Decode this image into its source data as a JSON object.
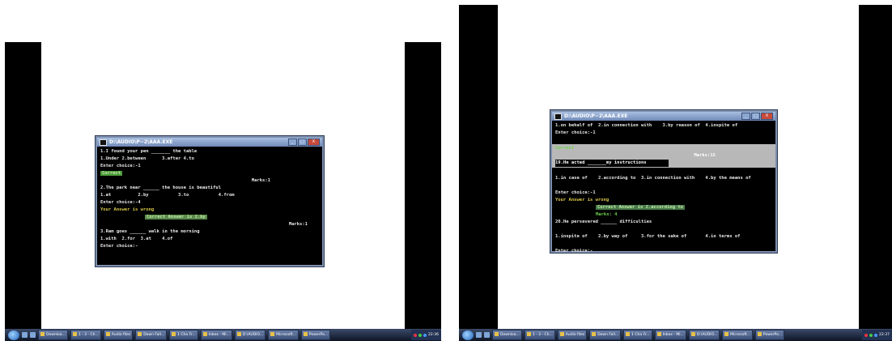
{
  "screens": [
    {
      "window": {
        "title": "D:\\AUDIO\\P~2\\AAA.EXE",
        "buttons": [
          "_",
          "□",
          "X"
        ],
        "lines": [
          {
            "text": "1.I found your pen _______ the table",
            "style": ""
          },
          {
            "text": "1.Under 2.between      3.after 4.to",
            "style": ""
          },
          {
            "text": "Enter choice:-1",
            "style": ""
          },
          {
            "text": "Correct",
            "style": "green-highlight"
          },
          {
            "text": "Marks:1",
            "style": "marks"
          },
          {
            "text": "2.The park near ______ the house is beautiful",
            "style": ""
          },
          {
            "text": "1.at          2.by           3.to           4.from",
            "style": ""
          },
          {
            "text": "Enter choice:-4",
            "style": ""
          },
          {
            "text": "Your Answer is wrong",
            "style": "yellow"
          },
          {
            "text": "Correct Answer is 2.by",
            "style": "answer"
          },
          {
            "text": "Marks:1",
            "style": "marks"
          },
          {
            "text": "3.Ram goes ______ walk in the morning",
            "style": ""
          },
          {
            "text": "1.with  2.for  3.at    4.of",
            "style": ""
          },
          {
            "text": "Enter choice:-",
            "style": ""
          }
        ]
      },
      "taskbar": {
        "items": [
          "Downloa...",
          "1 - 3 - Ch...",
          "Audio files",
          "Down Fall...",
          "1 Cha Fr...",
          "Inbox - Mi...",
          "D:\\AUDIO...",
          "Microsoft...",
          "PowerPo..."
        ],
        "clock": "22:36"
      }
    },
    {
      "window": {
        "title": "D:\\AUDIO\\P~2\\AAA.EXE",
        "buttons": [
          "_",
          "□",
          "X"
        ],
        "lines": [
          {
            "text": "1.on behalf of  2.in connection with    3.by reason of  4.inspite of",
            "style": ""
          },
          {
            "text": "Enter choice:-1",
            "style": ""
          },
          {
            "text": "",
            "style": "gap"
          },
          {
            "text": "Correct",
            "style": "gray-band-green"
          },
          {
            "text": "Marks:15",
            "style": "gray-band-marks"
          },
          {
            "text": "19.He acted _______my instructions",
            "style": "gray-band"
          },
          {
            "text": "",
            "style": "gap"
          },
          {
            "text": "1.in case of    2.according to  3.in connection with    4.by the means of",
            "style": ""
          },
          {
            "text": "",
            "style": "gap"
          },
          {
            "text": "Enter choice:-1",
            "style": ""
          },
          {
            "text": "Your Answer is wrong",
            "style": "yellow"
          },
          {
            "text": "Correct Answer is 2.according to",
            "style": "answer2"
          },
          {
            "text": "Marks: 4",
            "style": "marks-green"
          },
          {
            "text": "20.He persevered ______ difficulties",
            "style": ""
          },
          {
            "text": "",
            "style": "gap"
          },
          {
            "text": "1.inspite of    2.by way of     3.for the sake of       4.in terms of",
            "style": ""
          },
          {
            "text": "",
            "style": "gap"
          },
          {
            "text": "Enter choice:-",
            "style": ""
          }
        ]
      },
      "taskbar": {
        "items": [
          "Downloa...",
          "1 - 3 - Ch...",
          "Audio files",
          "Down Fall...",
          "1 Cha Fr...",
          "Inbox - Mi...",
          "D:\\AUDIO...",
          "Microsoft...",
          "PowerPo..."
        ],
        "clock": "22:37"
      }
    }
  ]
}
